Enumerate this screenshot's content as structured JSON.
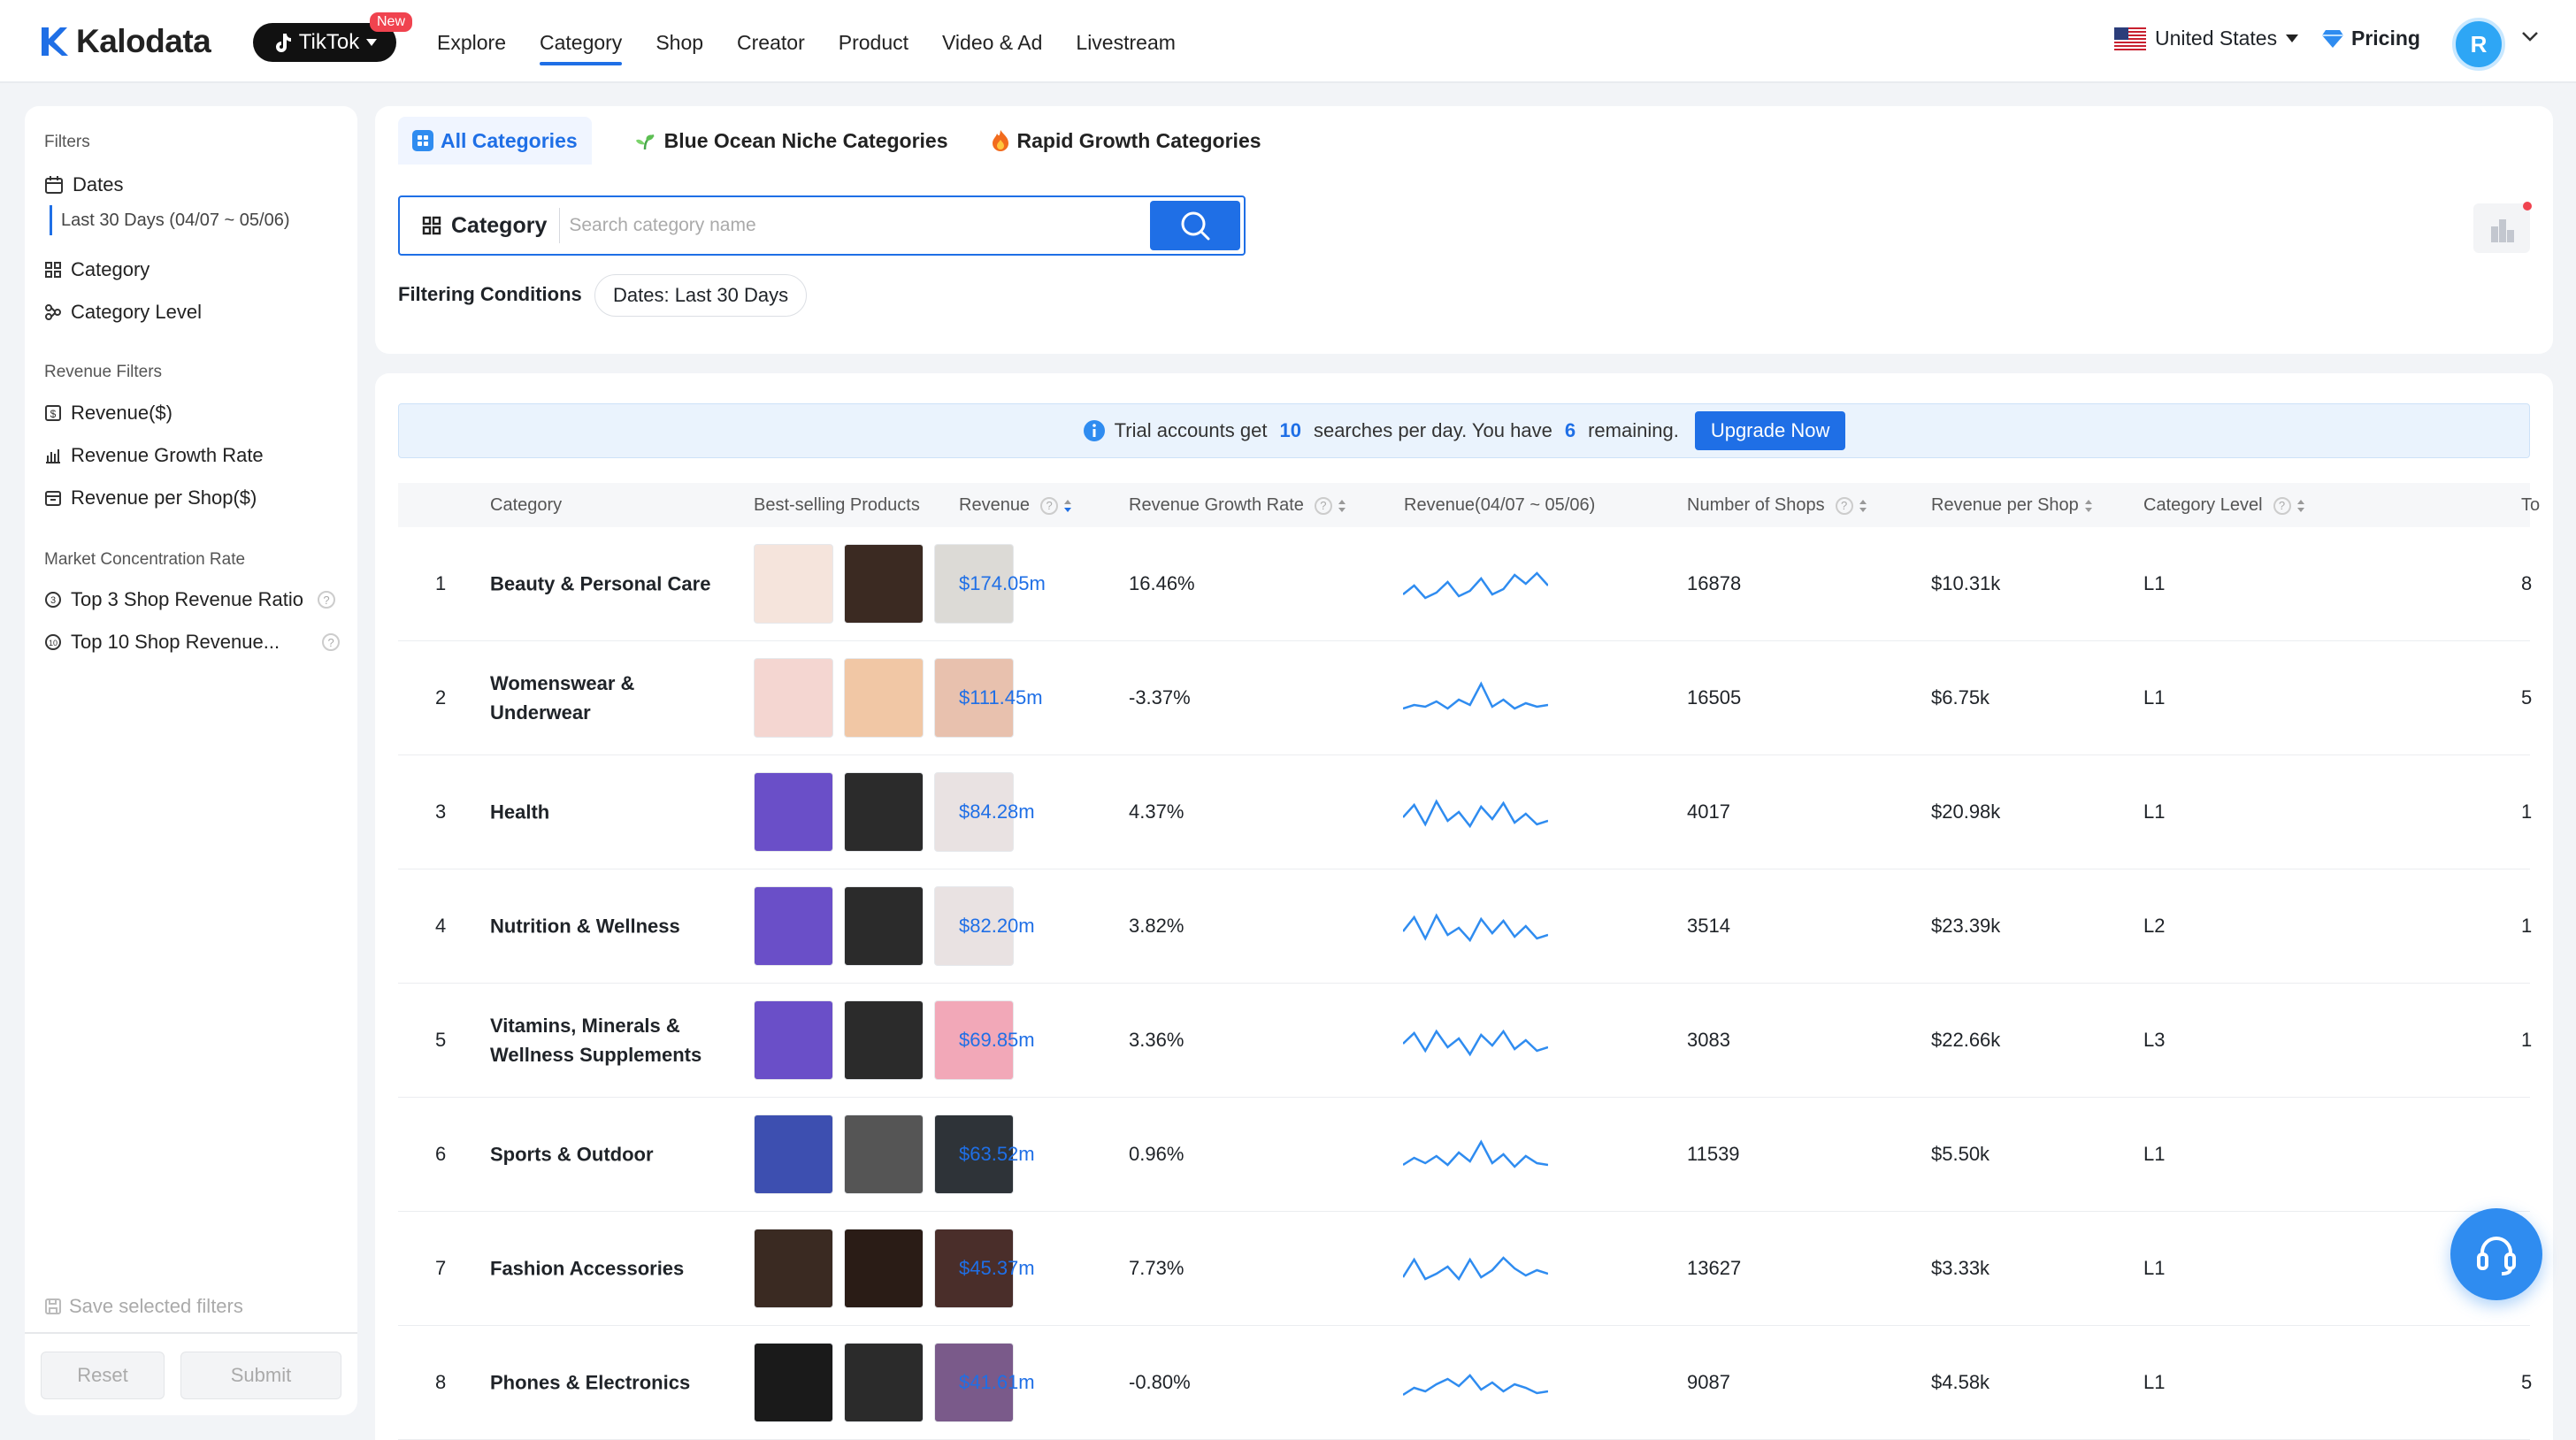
{
  "brand": {
    "name": "Kalodata"
  },
  "platform": {
    "label": "TikTok",
    "badge": "New"
  },
  "nav": [
    "Explore",
    "Category",
    "Shop",
    "Creator",
    "Product",
    "Video & Ad",
    "Livestream"
  ],
  "nav_active": "Category",
  "region": "United States",
  "pricing": "Pricing",
  "avatar_initial": "R",
  "sidebar": {
    "filters_title": "Filters",
    "dates_label": "Dates",
    "dates_value": "Last 30 Days (04/07 ~ 05/06)",
    "category": "Category",
    "category_level": "Category Level",
    "revenue_filters_title": "Revenue Filters",
    "revenue": "Revenue($)",
    "revenue_growth": "Revenue Growth Rate",
    "revenue_per_shop": "Revenue per Shop($)",
    "market_title": "Market Concentration Rate",
    "top3": "Top 3 Shop Revenue Ratio",
    "top10": "Top 10 Shop Revenue...",
    "save": "Save selected filters",
    "reset": "Reset",
    "submit": "Submit"
  },
  "tabs": [
    "All Categories",
    "Blue Ocean Niche Categories",
    "Rapid Growth Categories"
  ],
  "search": {
    "label": "Category",
    "placeholder": "Search category name"
  },
  "filtering": {
    "label": "Filtering Conditions",
    "chip": "Dates: Last 30 Days"
  },
  "trial": {
    "pre": "Trial accounts get",
    "limit": "10",
    "mid": "searches per day. You have",
    "remaining": "6",
    "post": "remaining.",
    "button": "Upgrade Now"
  },
  "columns": [
    "Category",
    "Best-selling Products",
    "Revenue",
    "Revenue Growth Rate",
    "Revenue(04/07 ~ 05/06)",
    "Number of Shops",
    "Revenue per Shop",
    "Category Level",
    "To"
  ],
  "rows": [
    {
      "rank": "1",
      "name": "Beauty & Personal Care",
      "revenue": "$174.05m",
      "growth": "16.46%",
      "shops": "16878",
      "per_shop": "$10.31k",
      "level": "L1",
      "extra": "8"
    },
    {
      "rank": "2",
      "name": "Womenswear & Underwear",
      "revenue": "$111.45m",
      "growth": "-3.37%",
      "shops": "16505",
      "per_shop": "$6.75k",
      "level": "L1",
      "extra": "5"
    },
    {
      "rank": "3",
      "name": "Health",
      "revenue": "$84.28m",
      "growth": "4.37%",
      "shops": "4017",
      "per_shop": "$20.98k",
      "level": "L1",
      "extra": "1"
    },
    {
      "rank": "4",
      "name": "Nutrition & Wellness",
      "revenue": "$82.20m",
      "growth": "3.82%",
      "shops": "3514",
      "per_shop": "$23.39k",
      "level": "L2",
      "extra": "1"
    },
    {
      "rank": "5",
      "name": "Vitamins, Minerals & Wellness Supplements",
      "revenue": "$69.85m",
      "growth": "3.36%",
      "shops": "3083",
      "per_shop": "$22.66k",
      "level": "L3",
      "extra": "1"
    },
    {
      "rank": "6",
      "name": "Sports & Outdoor",
      "revenue": "$63.52m",
      "growth": "0.96%",
      "shops": "11539",
      "per_shop": "$5.50k",
      "level": "L1",
      "extra": ""
    },
    {
      "rank": "7",
      "name": "Fashion Accessories",
      "revenue": "$45.37m",
      "growth": "7.73%",
      "shops": "13627",
      "per_shop": "$3.33k",
      "level": "L1",
      "extra": ""
    },
    {
      "rank": "8",
      "name": "Phones & Electronics",
      "revenue": "$41.61m",
      "growth": "-0.80%",
      "shops": "9087",
      "per_shop": "$4.58k",
      "level": "L1",
      "extra": "5"
    }
  ],
  "colors": {
    "accent": "#1f6fe6",
    "sparkline": "#2f8cf0",
    "badge": "#f0434f"
  }
}
